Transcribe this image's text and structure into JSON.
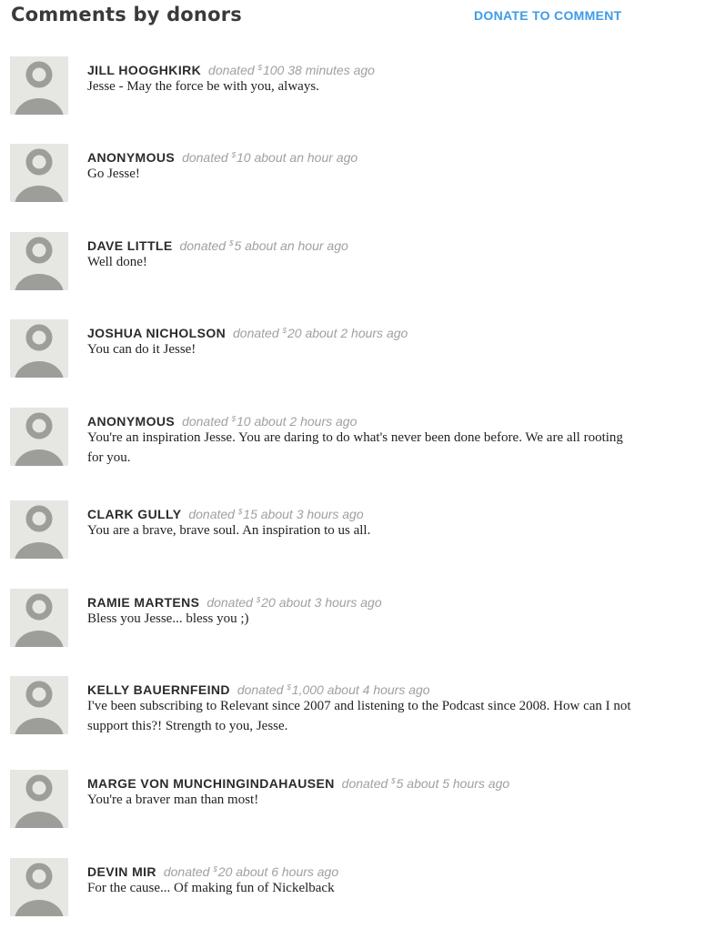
{
  "header": {
    "title": "Comments by donors",
    "donate_link": "DONATE TO COMMENT"
  },
  "colors": {
    "accent": "#3d9be9",
    "name": "#2b2b2b",
    "meta": "#a0a0a0",
    "avatar_bg": "#e6e6e3",
    "avatar_fg": "#9d9d9a"
  },
  "comments": [
    {
      "name": "JILL HOOGHKIRK",
      "donated_word": "donated",
      "currency": "$",
      "amount": "100",
      "time": "38 minutes ago",
      "text": "Jesse - May the force be with you, always.",
      "avatar_icon": "default-user-icon"
    },
    {
      "name": "ANONYMOUS",
      "donated_word": "donated",
      "currency": "$",
      "amount": "10",
      "time": "about an hour ago",
      "text": "Go Jesse!",
      "avatar_icon": "default-user-icon"
    },
    {
      "name": "DAVE LITTLE",
      "donated_word": "donated",
      "currency": "$",
      "amount": "5",
      "time": "about an hour ago",
      "text": "Well done!",
      "avatar_icon": "default-user-icon"
    },
    {
      "name": "JOSHUA NICHOLSON",
      "donated_word": "donated",
      "currency": "$",
      "amount": "20",
      "time": "about 2 hours ago",
      "text": "You can do it Jesse!",
      "avatar_icon": "default-user-icon"
    },
    {
      "name": "ANONYMOUS",
      "donated_word": "donated",
      "currency": "$",
      "amount": "10",
      "time": "about 2 hours ago",
      "text": "You're an inspiration Jesse. You are daring to do what's never been done before. We are all rooting for you.",
      "avatar_icon": "default-user-icon"
    },
    {
      "name": "CLARK GULLY",
      "donated_word": "donated",
      "currency": "$",
      "amount": "15",
      "time": "about 3 hours ago",
      "text": "You are a brave, brave soul. An inspiration to us all.",
      "avatar_icon": "default-user-icon"
    },
    {
      "name": "RAMIE MARTENS",
      "donated_word": "donated",
      "currency": "$",
      "amount": "20",
      "time": "about 3 hours ago",
      "text": "Bless you Jesse... bless you ;)",
      "avatar_icon": "default-user-icon"
    },
    {
      "name": "KELLY BAUERNFEIND",
      "donated_word": "donated",
      "currency": "$",
      "amount": "1,000",
      "time": "about 4 hours ago",
      "text": "I've been subscribing to Relevant since 2007 and listening to the Podcast since 2008. How can I not support this?! Strength to you, Jesse.",
      "avatar_icon": "default-user-icon"
    },
    {
      "name": "MARGE VON MUNCHINGINDAHAUSEN",
      "donated_word": "donated",
      "currency": "$",
      "amount": "5",
      "time": "about 5 hours ago",
      "text": "You're a braver man than most!",
      "avatar_icon": "default-user-icon"
    },
    {
      "name": "DEVIN MIR",
      "donated_word": "donated",
      "currency": "$",
      "amount": "20",
      "time": "about 6 hours ago",
      "text": "For the cause... Of making fun of Nickelback",
      "avatar_icon": "default-user-icon"
    }
  ]
}
